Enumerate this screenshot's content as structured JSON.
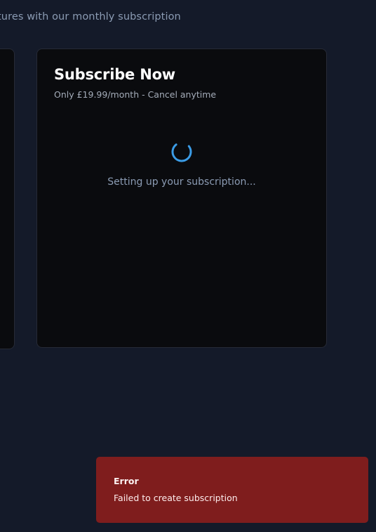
{
  "header": {
    "intro_text": "tures with our monthly subscription"
  },
  "subscribe_card": {
    "title": "Subscribe Now",
    "subtitle": "Only £19.99/month - Cancel anytime",
    "loading_text": "Setting up your subscription...",
    "spinner_icon": "loading-spinner-icon"
  },
  "toast": {
    "title": "Error",
    "message": "Failed to create subscription"
  },
  "colors": {
    "background": "#141a29",
    "card": "#0a0b0e",
    "spinner": "#3b9ce6",
    "error": "#7f1d1d"
  }
}
